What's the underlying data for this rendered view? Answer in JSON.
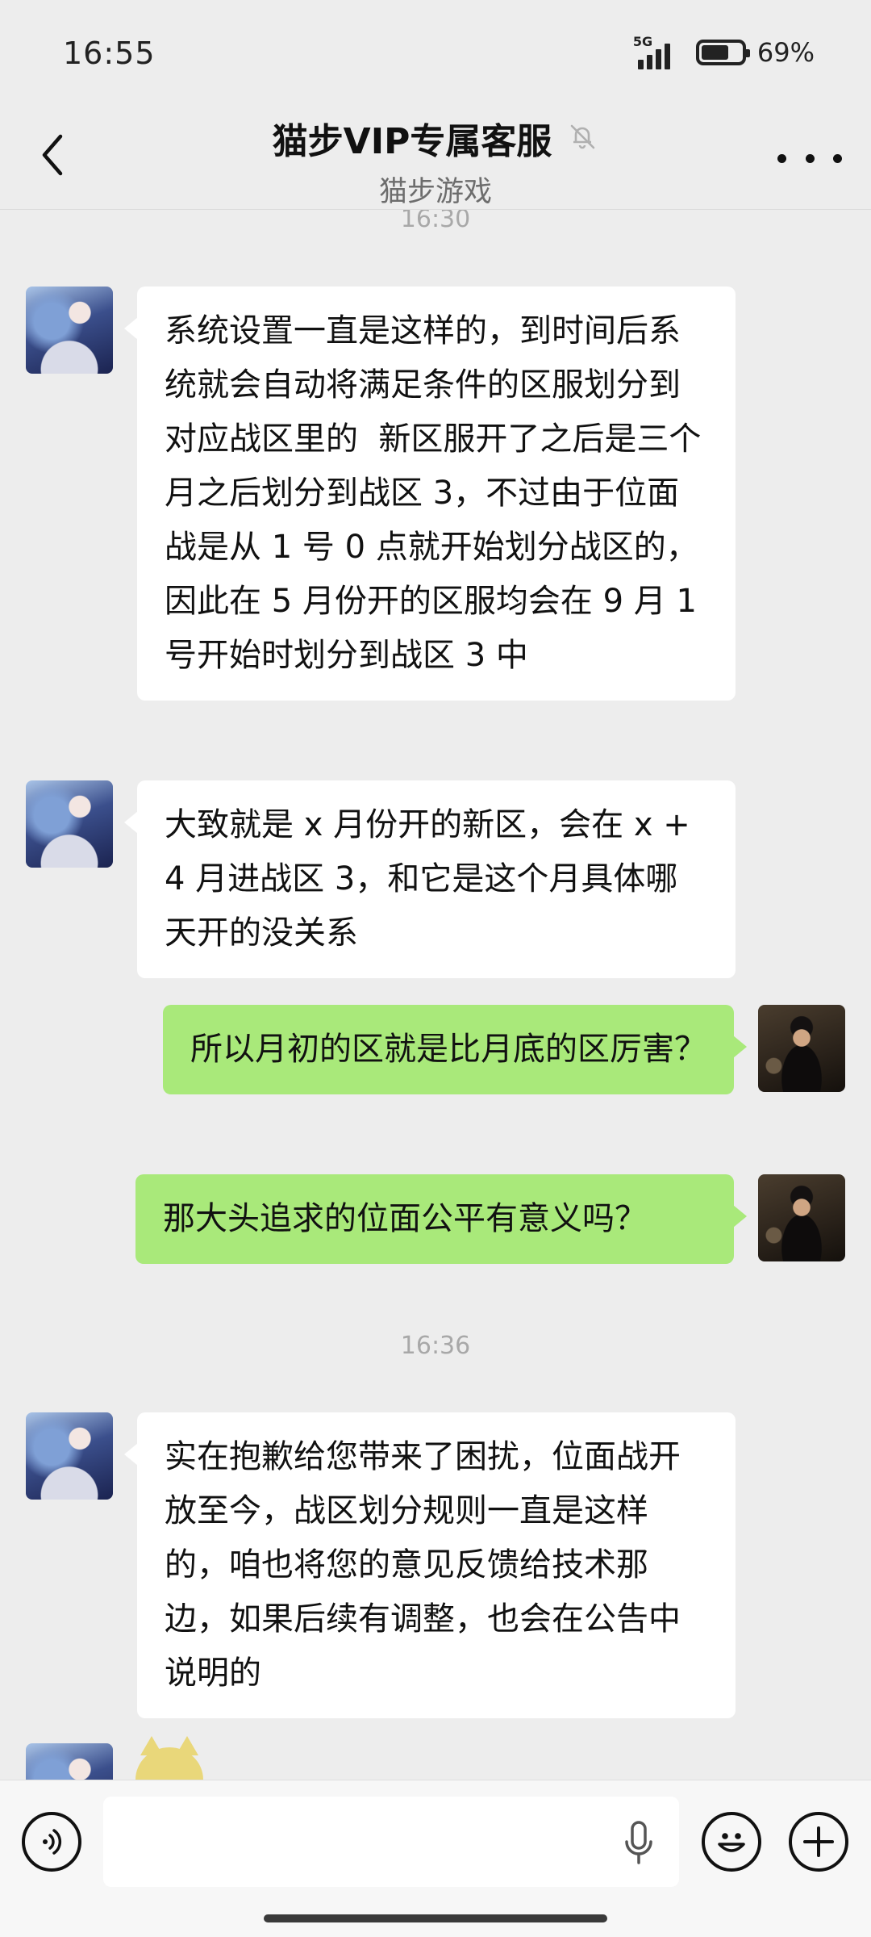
{
  "status_bar": {
    "time": "16:55",
    "network": "5G",
    "battery": "69%",
    "battery_level": 0.69
  },
  "header": {
    "title": "猫步VIP专属客服",
    "subtitle": "猫步游戏",
    "back_icon": "chevron-left-icon",
    "mute_icon": "bell-off-icon",
    "more_icon": "more-horizontal-icon"
  },
  "chat": {
    "time_1": "16:30",
    "time_2": "16:36",
    "messages": [
      {
        "sender": "service",
        "text": "系统设置一直是这样的，到时间后系统就会自动将满足条件的区服划分到对应战区里的  新区服开了之后是三个月之后划分到战区 3，不过由于位面战是从 1 号 0 点就开始划分战区的，因此在 5 月份开的区服均会在 9 月 1 号开始时划分到战区 3 中"
      },
      {
        "sender": "service",
        "text": "大致就是 x 月份开的新区，会在 x +4 月进战区 3，和它是这个月具体哪天开的没关系"
      },
      {
        "sender": "me",
        "text": "所以月初的区就是比月底的区厉害？"
      },
      {
        "sender": "me",
        "text": "那大头追求的位面公平有意义吗？"
      },
      {
        "sender": "service",
        "text": "实在抱歉给您带来了困扰，位面战开放至今，战区划分规则一直是这样的，咱也将您的意见反馈给技术那边，如果后续有调整，也会在公告中说明的"
      }
    ]
  },
  "input_bar": {
    "value": "",
    "icons": [
      "voice-icon",
      "microphone-icon",
      "emoji-icon",
      "plus-icon"
    ]
  },
  "colors": {
    "background": "#ededed",
    "bubble_in": "#ffffff",
    "bubble_out": "#a9e97a",
    "timestamp": "#a8a8a8"
  }
}
